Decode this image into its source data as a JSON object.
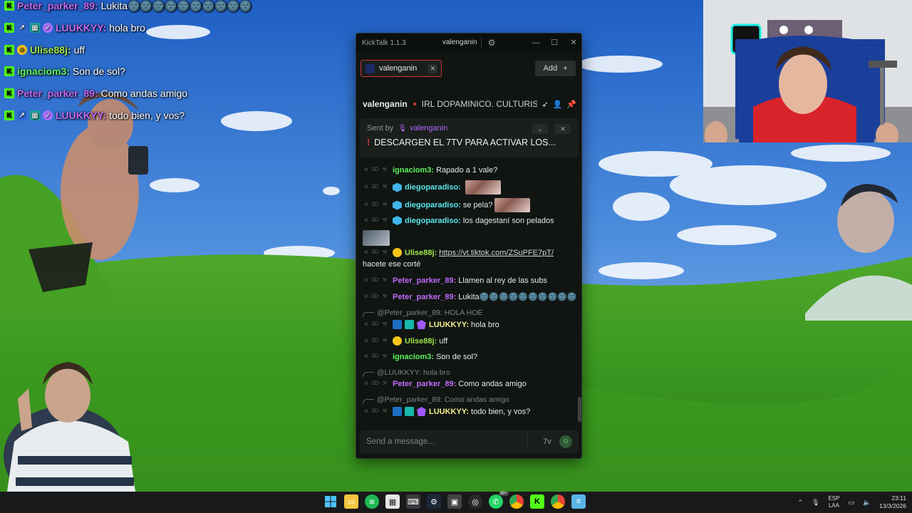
{
  "overlay_chat": [
    {
      "user": "Peter_parker_89:",
      "msg": "Lukita🌚🌚🌚🌚🌚🌚🌚🌚🌚🌚",
      "color": "#c26af8",
      "badges": []
    },
    {
      "user": "LUUKKYY:",
      "msg": "hola bro",
      "color": "#c26af8",
      "badges": [
        "blue",
        "teal",
        "purple"
      ]
    },
    {
      "user": "Ulise88j:",
      "msg": "uff",
      "color": "#9ee64c",
      "badges": [
        "yellow"
      ]
    },
    {
      "user": "ignaciom3:",
      "msg": "Son de sol?",
      "color": "#5ef25c",
      "badges": []
    },
    {
      "user": "Peter_parker_89:",
      "msg": "Como andas amigo",
      "color": "#c26af8",
      "badges": []
    },
    {
      "user": "LUUKKYY:",
      "msg": "todo bien, y vos?",
      "color": "#c26af8",
      "badges": [
        "blue",
        "teal",
        "purple"
      ]
    }
  ],
  "window": {
    "app_title": "KickTalk 1.1.3",
    "username": "valenganin",
    "gear_icon": "⚙",
    "minimize": "—",
    "maximize": "☐",
    "close": "✕"
  },
  "tabs": {
    "active": {
      "label": "valenganin",
      "close": "✕"
    },
    "add_label": "Add",
    "add_icon": "+"
  },
  "channel": {
    "name": "valenganin",
    "title": "IRL DOPAMINICO. CULTURIS...",
    "icons": [
      "pin-icon",
      "user-icon",
      "pushpin-icon"
    ]
  },
  "pinned": {
    "sent_by_label": "Sent by",
    "author": "valenganin",
    "text": "DESCARGEN EL 7TV PARA ACTIVAR LOS...",
    "expand": "⌄",
    "unpin": "✕"
  },
  "messages": [
    {
      "user": "ignaciom3:",
      "text": "Rapado a 1 vale?"
    },
    {
      "user": "diegoparadiso:",
      "text": ""
    },
    {
      "user": "diegoparadiso:",
      "text": "se pela?"
    },
    {
      "user": "diegoparadiso:",
      "text": "los dagestaní son pelados"
    },
    {
      "user": "Ulise88j:",
      "text": "https://vt.tiktok.com/ZSuPFE7pT/",
      "text2": "hacete ese corté"
    },
    {
      "user": "Peter_parker_89:",
      "text": "Llamen al rey de las subs"
    },
    {
      "user": "Peter_parker_89:",
      "text": "Lukita🌚🌚🌚🌚🌚🌚🌚🌚🌚🌚"
    },
    {
      "reply_to": "@Peter_parker_89:",
      "reply_text": "HOLA HOE"
    },
    {
      "user": "LUUKKYY:",
      "text": "hola bro"
    },
    {
      "user": "Ulise88j:",
      "text": "uff"
    },
    {
      "user": "ignaciom3:",
      "text": "Son de sol?"
    },
    {
      "reply_to": "@LUUKKYY:",
      "reply_text": "hola bro"
    },
    {
      "user": "Peter_parker_89:",
      "text": "Como andas amigo"
    },
    {
      "reply_to": "@Peter_parker_89:",
      "reply_text": "Como andas amigo"
    },
    {
      "user": "LUUKKYY:",
      "text": "todo bien, y vos?"
    }
  ],
  "input": {
    "placeholder": "Send a message...",
    "seventv_icon": "7v",
    "emoji_icon": "☺"
  },
  "taskbar": {
    "icons": [
      "windows-start",
      "file-explorer",
      "spotify",
      "microsoft-store",
      "keyboard-app",
      "steam",
      "terminal",
      "capture-tool",
      "whatsapp",
      "chrome",
      "kick",
      "chrome-profile",
      "notepad"
    ],
    "whatsapp_badge": "99+",
    "tray_chevron": "⌃",
    "lang_1": "ESP",
    "lang_2": "LAA",
    "time": "23:11",
    "date": "13/3/2026"
  },
  "colors": {
    "kick_green": "#53fc18",
    "live_red": "#d23a3a",
    "accent_purple": "#b567ff",
    "tab_border": "#c9353b"
  }
}
